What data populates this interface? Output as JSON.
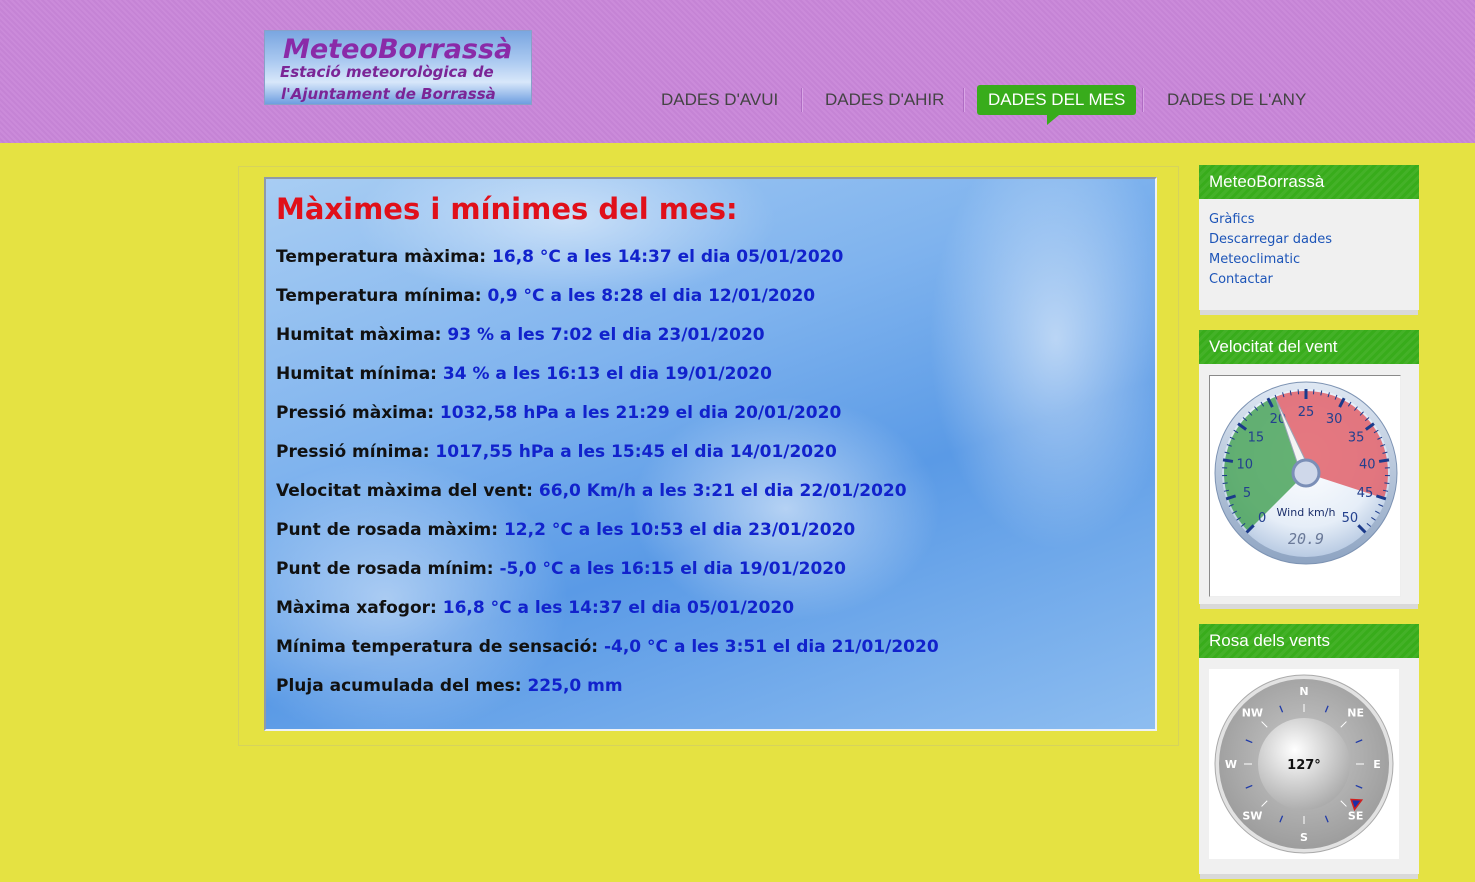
{
  "header": {
    "logo": {
      "line1": "MeteoBorrassà",
      "line2": "Estació meteorològica de",
      "line3": "l'Ajuntament de Borrassà"
    },
    "nav": [
      {
        "label": "DADES D'AVUI",
        "active": false
      },
      {
        "label": "DADES D'AHIR",
        "active": false
      },
      {
        "label": "DADES DEL MES",
        "active": true
      },
      {
        "label": "DADES DE L'ANY",
        "active": false
      }
    ]
  },
  "main": {
    "title": "Màximes i mínimes del mes:",
    "stats": [
      {
        "label": "Temperatura màxima:",
        "value": "16,8 °C a les 14:37 el dia 05/01/2020"
      },
      {
        "label": "Temperatura mínima:",
        "value": "0,9 °C a les 8:28 el dia 12/01/2020"
      },
      {
        "label": "Humitat màxima:",
        "value": "93 % a les 7:02 el dia 23/01/2020"
      },
      {
        "label": "Humitat mínima:",
        "value": "34 % a les 16:13 el dia 19/01/2020"
      },
      {
        "label": "Pressió màxima:",
        "value": "1032,58 hPa a les 21:29 el dia 20/01/2020"
      },
      {
        "label": "Pressió mínima:",
        "value": "1017,55 hPa a les 15:45 el dia 14/01/2020"
      },
      {
        "label": "Velocitat màxima del vent:",
        "value": "66,0 Km/h a les 3:21 el dia 22/01/2020"
      },
      {
        "label": "Punt de rosada màxim:",
        "value": "12,2 °C a les 10:53 el dia 23/01/2020"
      },
      {
        "label": "Punt de rosada mínim:",
        "value": "-5,0 °C a les 16:15 el dia 19/01/2020"
      },
      {
        "label": "Màxima xafogor:",
        "value": "16,8 °C a les 14:37 el dia 05/01/2020"
      },
      {
        "label": "Mínima temperatura de sensació:",
        "value": "-4,0 °C a les 3:51 el dia 21/01/2020"
      },
      {
        "label": "Pluja acumulada del mes:",
        "value": "225,0 mm"
      }
    ]
  },
  "sidebar": {
    "links_widget": {
      "title": "MeteoBorrassà",
      "links": [
        "Gràfics",
        "Descarregar dades",
        "Meteoclimatic",
        "Contactar"
      ]
    },
    "wind_speed_widget": {
      "title": "Velocitat del vent",
      "gauge_label": "Wind km/h",
      "readout": "20.9",
      "value": 20.9,
      "min": 0,
      "max": 50,
      "ticks": [
        "0",
        "5",
        "10",
        "15",
        "20",
        "25",
        "30",
        "35",
        "40",
        "45",
        "50"
      ]
    },
    "wind_rose_widget": {
      "title": "Rosa dels vents",
      "direction_readout": "127°",
      "direction_deg": 127,
      "compass_labels": [
        "N",
        "NE",
        "E",
        "SE",
        "S",
        "SW",
        "W",
        "NW"
      ]
    }
  },
  "colors": {
    "page_background": "#e5e242",
    "header_background": "#c986d9",
    "accent_green": "#38ac1b",
    "title_red": "#e0101a",
    "value_blue": "#1122cc",
    "link_blue": "#1d55b8"
  }
}
